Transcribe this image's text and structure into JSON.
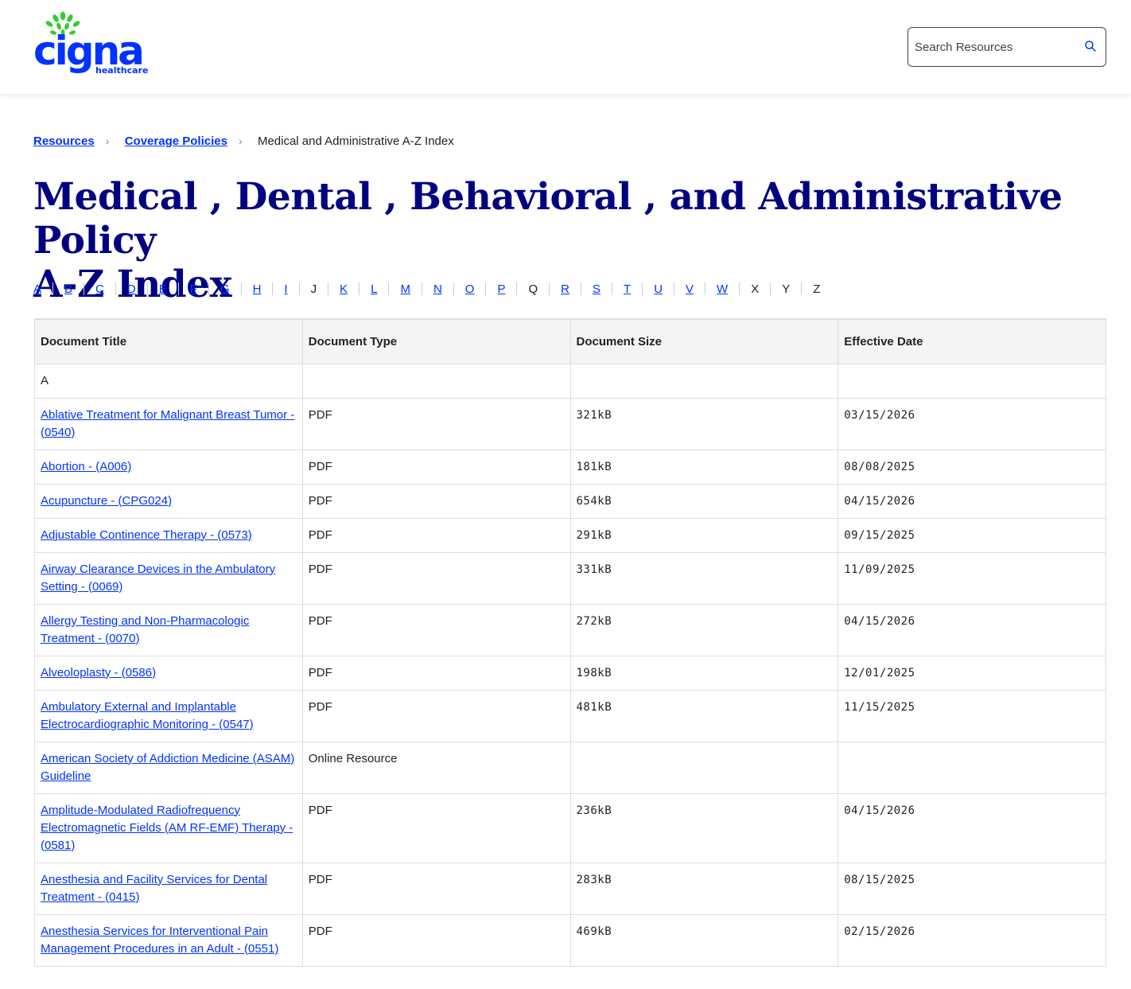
{
  "brand": {
    "name": "cigna",
    "sub": "healthcare",
    "primary_color": "#0033ff",
    "leaf_color": "#33cc33",
    "title_color": "#000080"
  },
  "search": {
    "placeholder": "Search Resources",
    "icon": "search-icon"
  },
  "breadcrumb": {
    "items": [
      "Resources",
      "Coverage Policies"
    ],
    "current": "Medical and Administrative A-Z Index"
  },
  "page_title": {
    "line1": "Medical ,  Dental ,  Behavioral ,  and Administrative Policy",
    "line2": "A-Z Index"
  },
  "az": [
    {
      "letter": "A",
      "link": true
    },
    {
      "letter": "B",
      "link": true
    },
    {
      "letter": "C",
      "link": true
    },
    {
      "letter": "D",
      "link": true
    },
    {
      "letter": "E",
      "link": true
    },
    {
      "letter": "F",
      "link": true
    },
    {
      "letter": "G",
      "link": true
    },
    {
      "letter": "H",
      "link": true
    },
    {
      "letter": "I",
      "link": true
    },
    {
      "letter": "J",
      "link": false
    },
    {
      "letter": "K",
      "link": true
    },
    {
      "letter": "L",
      "link": true
    },
    {
      "letter": "M",
      "link": true
    },
    {
      "letter": "N",
      "link": true
    },
    {
      "letter": "O",
      "link": true
    },
    {
      "letter": "P",
      "link": true
    },
    {
      "letter": "Q",
      "link": false
    },
    {
      "letter": "R",
      "link": true
    },
    {
      "letter": "S",
      "link": true
    },
    {
      "letter": "T",
      "link": true
    },
    {
      "letter": "U",
      "link": true
    },
    {
      "letter": "V",
      "link": true
    },
    {
      "letter": "W",
      "link": true
    },
    {
      "letter": "X",
      "link": false
    },
    {
      "letter": "Y",
      "link": false
    },
    {
      "letter": "Z",
      "link": false
    }
  ],
  "table": {
    "headers": [
      "Document Title",
      "Document Type",
      "Document Size",
      "Effective Date"
    ],
    "section_letter": "A",
    "rows": [
      {
        "title": "Ablative Treatment for Malignant Breast Tumor - (0540)",
        "type": "PDF",
        "size": "321kB",
        "date": "03/15/2026"
      },
      {
        "title": "Abortion - (A006)",
        "type": "PDF",
        "size": "181kB",
        "date": "08/08/2025"
      },
      {
        "title": "Acupuncture - (CPG024)",
        "type": "PDF",
        "size": "654kB",
        "date": "04/15/2026"
      },
      {
        "title": "Adjustable Continence Therapy - (0573)",
        "type": "PDF",
        "size": "291kB",
        "date": "09/15/2025"
      },
      {
        "title": "Airway Clearance Devices in the Ambulatory Setting - (0069)",
        "type": "PDF",
        "size": "331kB",
        "date": "11/09/2025"
      },
      {
        "title": "Allergy Testing and Non-Pharmacologic Treatment - (0070)",
        "type": "PDF",
        "size": "272kB",
        "date": "04/15/2026"
      },
      {
        "title": "Alveoloplasty - (0586)",
        "type": "PDF",
        "size": "198kB",
        "date": "12/01/2025"
      },
      {
        "title": "Ambulatory External and Implantable Electrocardiographic Monitoring - (0547)",
        "type": "PDF",
        "size": "481kB",
        "date": "11/15/2025"
      },
      {
        "title": "American Society of Addiction Medicine (ASAM) Guideline",
        "type": "Online Resource",
        "size": "",
        "date": ""
      },
      {
        "title": "Amplitude-Modulated Radiofrequency Electromagnetic Fields (AM RF-EMF) Therapy - (0581)",
        "type": "PDF",
        "size": "236kB",
        "date": "04/15/2026"
      },
      {
        "title": "Anesthesia and Facility Services for Dental Treatment - (0415)",
        "type": "PDF",
        "size": "283kB",
        "date": "08/15/2025"
      },
      {
        "title": "Anesthesia Services for Interventional Pain Management Procedures in an Adult - (0551)",
        "type": "PDF",
        "size": "469kB",
        "date": "02/15/2026"
      }
    ]
  }
}
